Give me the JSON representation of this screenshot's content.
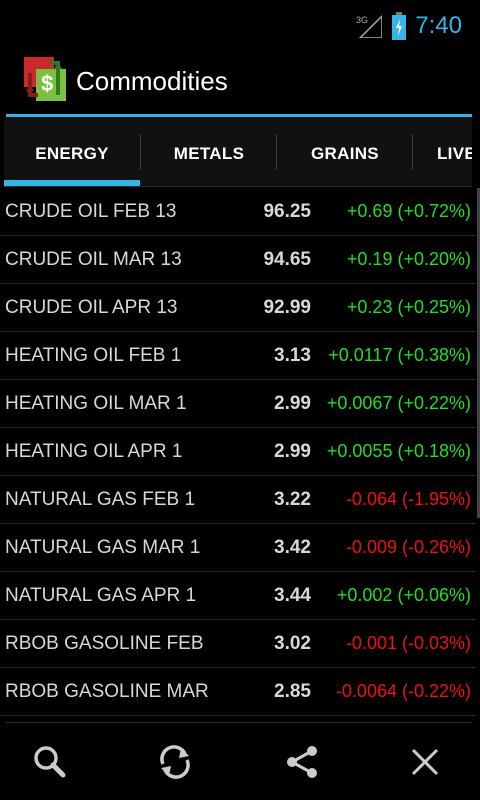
{
  "status_bar": {
    "network_label": "3G",
    "time": "7:40",
    "accent_color": "#33b5e5"
  },
  "app": {
    "title": "Commodities",
    "icon": "commodities-logo-icon"
  },
  "tabs": [
    {
      "label": "ENERGY",
      "selected": true
    },
    {
      "label": "METALS",
      "selected": false
    },
    {
      "label": "GRAINS",
      "selected": false
    },
    {
      "label": "LIVE",
      "selected": false
    }
  ],
  "quotes": [
    {
      "name": "CRUDE OIL FEB 13",
      "price": "96.25",
      "change": "+0.69 (+0.72%)",
      "direction": "up"
    },
    {
      "name": "CRUDE OIL MAR 13",
      "price": "94.65",
      "change": "+0.19 (+0.20%)",
      "direction": "up"
    },
    {
      "name": "CRUDE OIL APR 13",
      "price": "92.99",
      "change": "+0.23 (+0.25%)",
      "direction": "up"
    },
    {
      "name": "HEATING OIL FEB 1",
      "price": "3.13",
      "change": "+0.0117 (+0.38%)",
      "direction": "up"
    },
    {
      "name": "HEATING OIL MAR 1",
      "price": "2.99",
      "change": "+0.0067 (+0.22%)",
      "direction": "up"
    },
    {
      "name": "HEATING OIL APR 1",
      "price": "2.99",
      "change": "+0.0055 (+0.18%)",
      "direction": "up"
    },
    {
      "name": "NATURAL GAS FEB 1",
      "price": "3.22",
      "change": "-0.064 (-1.95%)",
      "direction": "down"
    },
    {
      "name": "NATURAL GAS MAR 1",
      "price": "3.42",
      "change": "-0.009 (-0.26%)",
      "direction": "down"
    },
    {
      "name": "NATURAL GAS APR 1",
      "price": "3.44",
      "change": "+0.002 (+0.06%)",
      "direction": "up"
    },
    {
      "name": "RBOB GASOLINE FEB",
      "price": "3.02",
      "change": "-0.001 (-0.03%)",
      "direction": "down"
    },
    {
      "name": "RBOB GASOLINE MAR",
      "price": "2.85",
      "change": "-0.0064 (-0.22%)",
      "direction": "down"
    }
  ],
  "colors": {
    "up": "#22dd22",
    "down": "#ee1111"
  },
  "bottom_actions": [
    {
      "name": "search-button",
      "icon": "search-icon"
    },
    {
      "name": "refresh-button",
      "icon": "refresh-icon"
    },
    {
      "name": "share-button",
      "icon": "share-icon"
    },
    {
      "name": "close-button",
      "icon": "close-icon"
    }
  ]
}
